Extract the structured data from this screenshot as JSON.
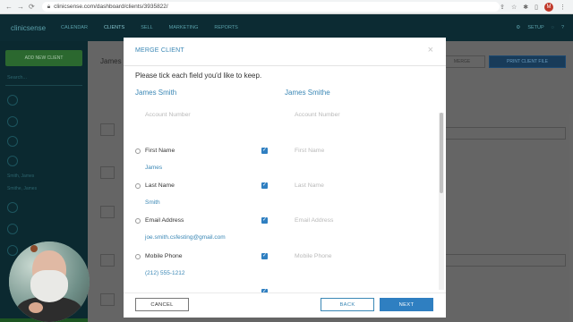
{
  "browser": {
    "url": "clinicsense.com/dashboard/clients/3935822/",
    "profile_initial": "M"
  },
  "app": {
    "logo": "clinicsense",
    "nav": [
      "CALENDAR",
      "CLIENTS",
      "SELL",
      "MARKETING",
      "REPORTS"
    ],
    "setup": "SETUP"
  },
  "sidebar": {
    "add_button": "ADD NEW CLIENT",
    "search_placeholder": "Search...",
    "clients": [
      "Smith, James",
      "Smithe, James"
    ]
  },
  "main": {
    "client_title": "James S",
    "merge_button": "MERGE",
    "print_button": "PRINT CLIENT FILE"
  },
  "modal": {
    "title": "MERGE CLIENT",
    "instruction": "Please tick each field you'd like to keep.",
    "left_name": "James Smith",
    "right_name": "James Smithe",
    "fields": [
      {
        "label": "Account Number",
        "left_value": "",
        "right_value": ""
      },
      {
        "label": "First Name",
        "left_value": "James",
        "right_value": ""
      },
      {
        "label": "Last Name",
        "left_value": "Smith",
        "right_value": ""
      },
      {
        "label": "Email Address",
        "left_value": "joe.smith.csfesting@gmail.com",
        "right_value": ""
      },
      {
        "label": "Mobile Phone",
        "left_value": "(212) 555-1212",
        "right_value": ""
      }
    ],
    "buttons": {
      "cancel": "CANCEL",
      "back": "BACK",
      "next": "NEXT"
    }
  },
  "colors": {
    "accent": "#3a87b5",
    "primary_button": "#2f7fc1",
    "checkbox": "#2f7fc1"
  }
}
